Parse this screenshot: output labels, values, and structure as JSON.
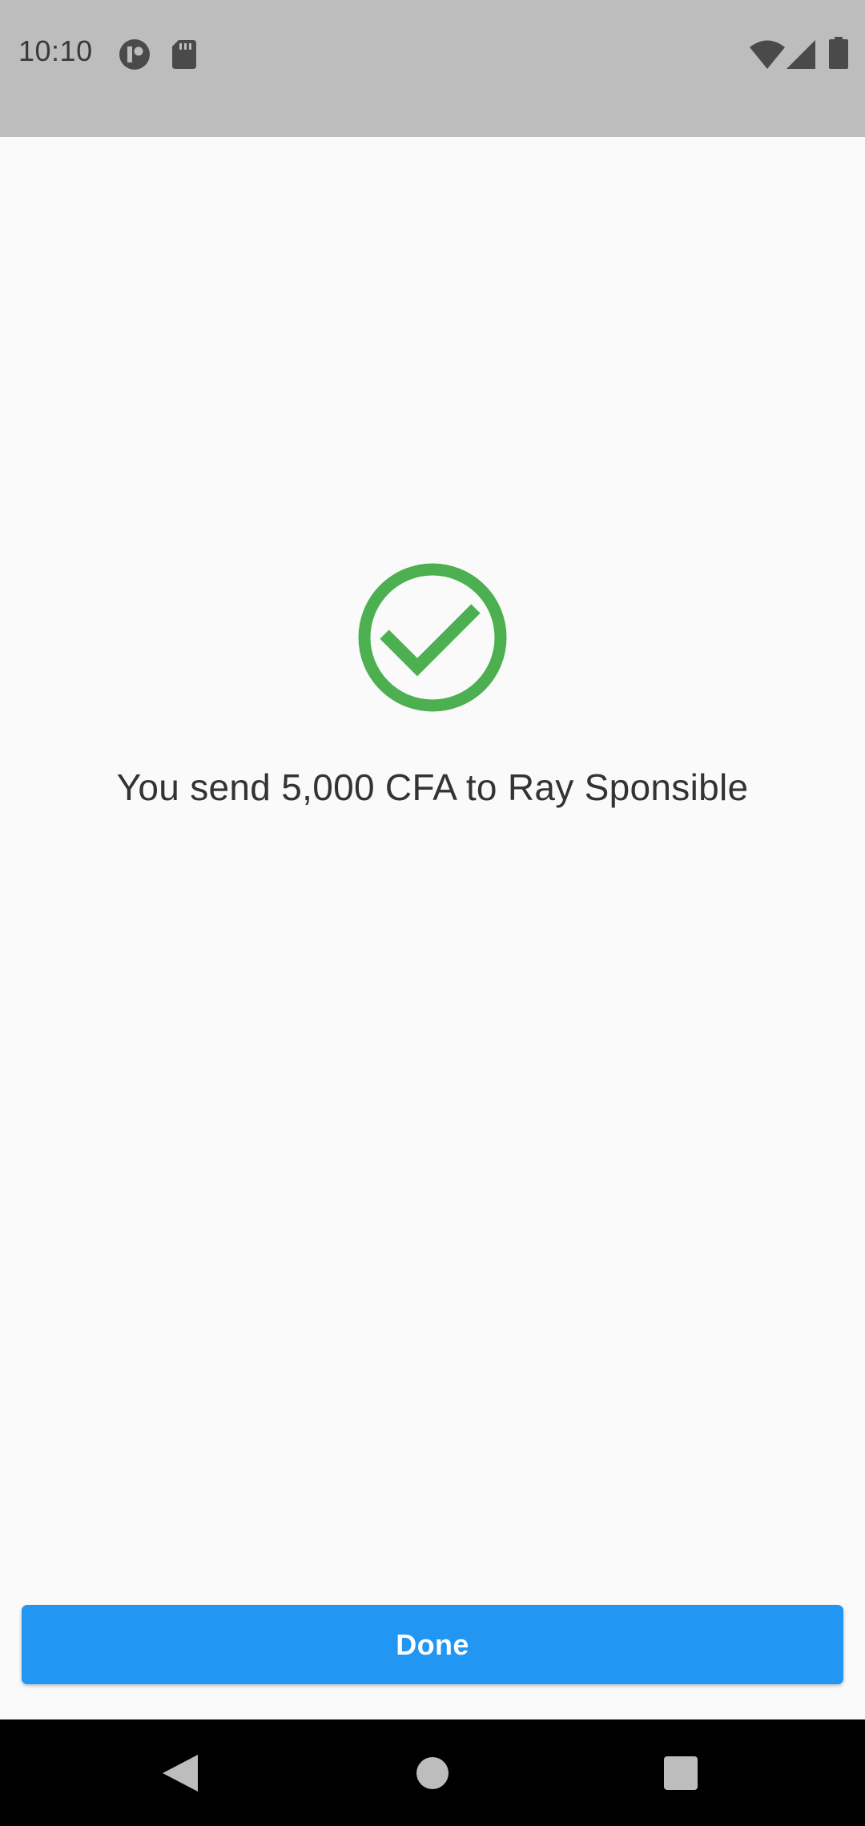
{
  "status_bar": {
    "time": "10:10",
    "icons": [
      "app-notification-icon",
      "sd-card-icon",
      "wifi-icon",
      "cellular-signal-icon",
      "battery-icon"
    ]
  },
  "main": {
    "status_icon": "check-circle-icon",
    "message": "You send 5,000 CFA to Ray Sponsible"
  },
  "footer": {
    "done_label": "Done"
  },
  "navigation_bar": {
    "buttons": [
      "back-icon",
      "home-icon",
      "recents-icon"
    ]
  },
  "colors": {
    "status_bar_bg": "#bdbdbd",
    "page_bg": "#fafafa",
    "success_green": "#4caf50",
    "primary_button": "#2196f3",
    "nav_bar_bg": "#000000"
  }
}
